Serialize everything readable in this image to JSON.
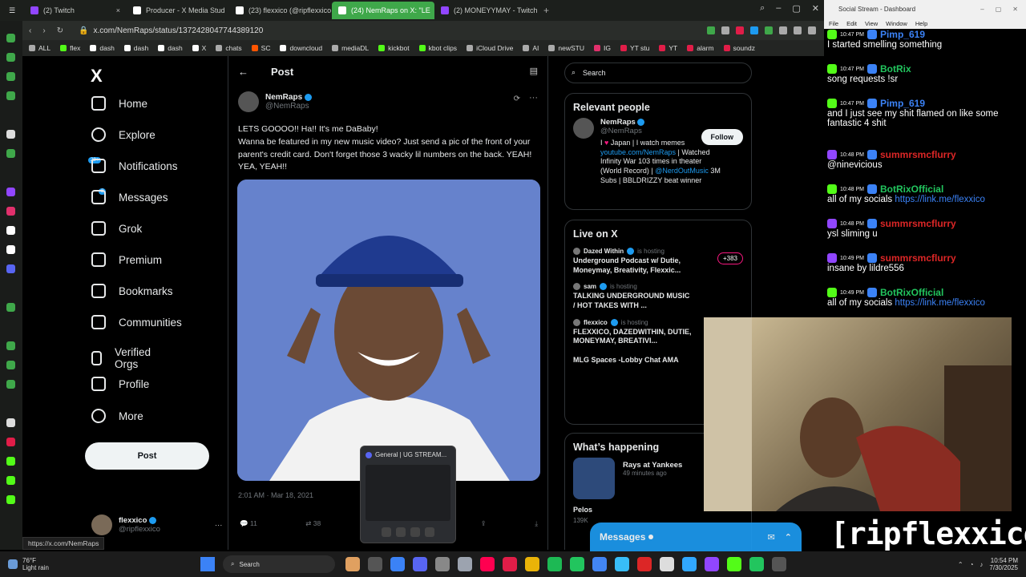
{
  "browser": {
    "tabs": [
      {
        "label": "(2) Twitch",
        "color": "#9146ff",
        "active": false
      },
      {
        "label": "Producer - X Media Stud",
        "color": "#ffffff",
        "active": false
      },
      {
        "label": "(23) flexxico (@ripflexxico",
        "color": "#ffffff",
        "active": false
      },
      {
        "label": "(24) NemRaps on X: \"LE",
        "color": "#ffffff",
        "active": true
      },
      {
        "label": "(2) MONEYYMAY - Twitch",
        "color": "#9146ff",
        "active": false
      }
    ],
    "url": "x.com/NemRaps/status/1372428047744389120",
    "bookmarks": [
      "ALL",
      "flex",
      "dash",
      "dash",
      "dash",
      "X",
      "chats",
      "SC",
      "downcloud",
      "mediaDL",
      "kickbot",
      "kbot clips",
      "iCloud Drive",
      "AI",
      "newSTU",
      "IG",
      "YT stu",
      "YT",
      "alarm",
      "soundz"
    ],
    "status_url": "https://x.com/NemRaps"
  },
  "x": {
    "logo": "X",
    "nav": [
      "Home",
      "Explore",
      "Notifications",
      "Messages",
      "Grok",
      "Premium",
      "Bookmarks",
      "Communities",
      "Verified Orgs",
      "Profile",
      "More"
    ],
    "notif_badge": "20+",
    "msg_badge": "3",
    "post_button": "Post",
    "account": {
      "name": "flexxico",
      "handle": "@ripflexxico"
    }
  },
  "post": {
    "header": "Post",
    "author": "NemRaps",
    "handle": "@NemRaps",
    "text": "LETS GOOOO!! Ha!! It's me DaBaby!\nWanna be featured in my new music video? Just send a pic of the front of your parent's credit card. Don't forget those 3 wacky lil numbers on the back. YEAH! YEA, YEAH!!",
    "time": "2:01 AM · Mar 18, 2021",
    "replies": "11",
    "reposts": "38"
  },
  "sidebar": {
    "search_placeholder": "Search",
    "relevant_title": "Relevant people",
    "person": {
      "name": "NemRaps",
      "handle": "@NemRaps",
      "follow": "Follow",
      "bio_a": "I ",
      "bio_b": " Japan | I watch memes",
      "bio_link": "youtube.com/NemRaps",
      "bio_c": " | Watched Infinity War 103 times in theater (World Record) | ",
      "bio_mention": "@NerdOutMusic",
      "bio_d": " 3M Subs | BBLDRIZZY beat winner"
    },
    "live_title": "Live on X",
    "is_hosting": "is hosting",
    "live": [
      {
        "host": "Dazed Within",
        "title": "Underground Podcast w/ Dutie, Moneymay, Breativity, Flexxic...",
        "badge": "+383"
      },
      {
        "host": "sam",
        "title": "TALKING UNDERGROUND MUSIC / HOT TAKES WITH ...",
        "badge": ""
      },
      {
        "host": "flexxico",
        "title": "FLEXXICO, DAZEDWITHIN, DUTIE, MONEYMAY, BREATIVI...",
        "badge": ""
      },
      {
        "host": "",
        "title": "MLG Spaces -Lobby Chat AMA",
        "badge": ""
      }
    ],
    "happening_title": "What’s happening",
    "happening": [
      {
        "title": "Rays at Yankees",
        "meta": "49 minutes ago"
      }
    ],
    "partial_1": "Pelos",
    "partial_2": "139K"
  },
  "popup": {
    "title": "General | UG STREAM..."
  },
  "drawer": {
    "title": "Messages"
  },
  "stream": {
    "window_title": "Social Stream - Dashboard",
    "menu": [
      "File",
      "Edit",
      "View",
      "Window",
      "Help"
    ],
    "messages": [
      {
        "time": "10:47 PM",
        "user": "Pimp_619",
        "ucolor": "#3b82f6",
        "text": "I started smelling something"
      },
      {
        "time": "10:47 PM",
        "user": "BotRix",
        "ucolor": "#22c55e",
        "text": "song requests !sr"
      },
      {
        "time": "10:47 PM",
        "user": "Pimp_619",
        "ucolor": "#3b82f6",
        "text": "and I just see my shit flamed on like some fantastic 4 shit"
      },
      {
        "time": "10:48 PM",
        "user": "summrsmcflurry",
        "ucolor": "#dc2626",
        "text": "@ninevicious"
      },
      {
        "time": "10:48 PM",
        "user": "BotRixOfficial",
        "ucolor": "#22c55e",
        "text": "all of my socials ",
        "link": "https://link.me/flexxico"
      },
      {
        "time": "10:48 PM",
        "user": "summrsmcflurry",
        "ucolor": "#dc2626",
        "text": "ysl sliming u"
      },
      {
        "time": "10:49 PM",
        "user": "summrsmcflurry",
        "ucolor": "#dc2626",
        "text": "insane by lildre556"
      },
      {
        "time": "10:49 PM",
        "user": "BotRixOfficial",
        "ucolor": "#22c55e",
        "text": "all of my socials ",
        "link": "https://link.me/flexxico"
      }
    ],
    "cam_title": "[ripflexxico]"
  },
  "taskbar": {
    "weather_temp": "76°F",
    "weather_desc": "Light rain",
    "search": "Search",
    "time": "10:54 PM",
    "date": "7/30/2025"
  },
  "colors": {
    "accent": "#1d9bf0",
    "tab_active": "#3fa84a"
  }
}
